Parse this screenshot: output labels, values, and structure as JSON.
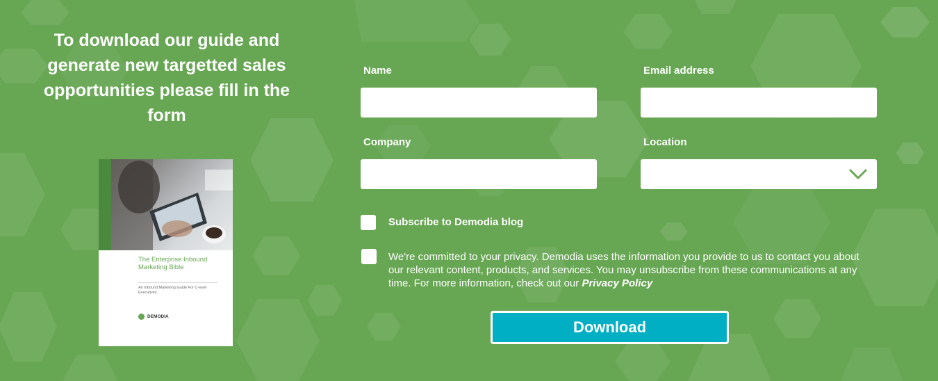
{
  "headline": "To download our guide and generate new targetted sales opportunities please fill in the form",
  "guide_cover": {
    "title": "The Enterprise Inbound Marketing Bible",
    "subtitle": "An Inbound Marketing Guide For C-level Executives",
    "brand": "DEMODIA"
  },
  "form": {
    "name_label": "Name",
    "name_value": "",
    "email_label": "Email address",
    "email_value": "",
    "company_label": "Company",
    "company_value": "",
    "location_label": "Location",
    "location_value": "",
    "subscribe_label": "Subscribe to Demodia blog",
    "subscribe_checked": false,
    "privacy_text": "We're committed to your privacy. Demodia uses the information you provide to us to contact you about our relevant content, products, and services. You may unsubscribe from these communications at any time. For more information, check out our",
    "privacy_link": "Privacy Policy",
    "privacy_checked": false,
    "submit_label": "Download"
  },
  "colors": {
    "background": "#67a653",
    "accent_button": "#00afc4",
    "chevron": "#67a653"
  },
  "icons": {
    "location_dropdown": "chevron-down-icon"
  }
}
